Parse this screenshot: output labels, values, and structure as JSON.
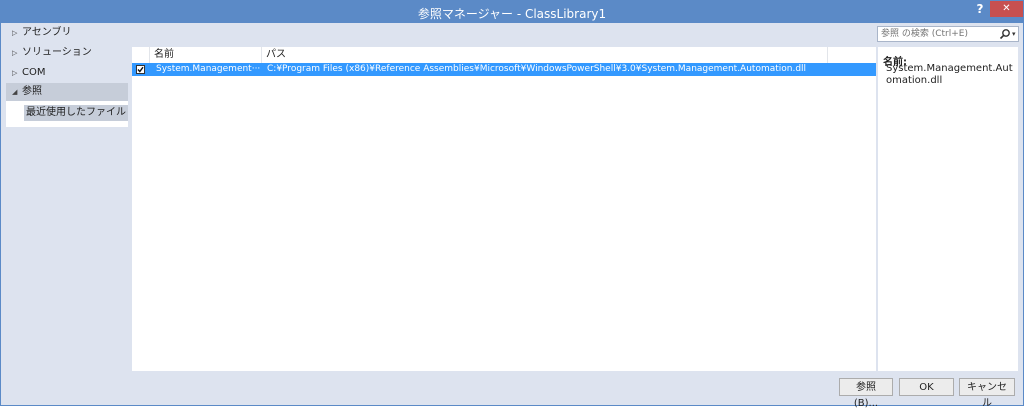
{
  "window": {
    "title": "参照マネージャー - ClassLibrary1",
    "help_label": "?",
    "close_label": "✕"
  },
  "sidebar": {
    "items": [
      {
        "label": "アセンブリ",
        "arrow": "▷"
      },
      {
        "label": "ソリューション",
        "arrow": "▷"
      },
      {
        "label": "COM",
        "arrow": "▷"
      },
      {
        "label": "参照",
        "arrow": "◢"
      }
    ],
    "subitem": "最近使用したファイル"
  },
  "search": {
    "placeholder": "参照 の検索 (Ctrl+E)",
    "icon": "search-icon"
  },
  "grid": {
    "headers": [
      "名前",
      "パス"
    ],
    "rows": [
      {
        "checked": true,
        "name": "System.Management···",
        "path": "C:¥Program Files (x86)¥Reference Assemblies¥Microsoft¥WindowsPowerShell¥3.0¥System.Management.Automation.dll"
      }
    ]
  },
  "details": {
    "label": "名前:",
    "value": "System.Management.Automation.dll"
  },
  "buttons": {
    "browse": "参照(B)...",
    "ok": "OK",
    "cancel": "キャンセル"
  },
  "colors": {
    "titlebar": "#5b8ac7",
    "selection": "#3399ff",
    "close": "#c75050"
  }
}
